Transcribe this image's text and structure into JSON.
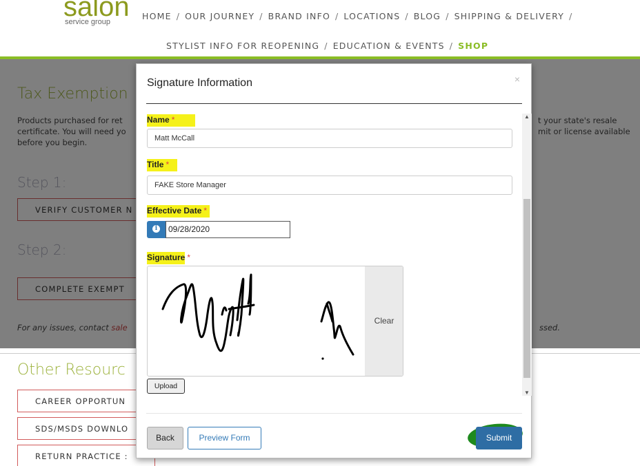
{
  "header": {
    "logo_word": "salon",
    "logo_sub": "service group",
    "nav_row1": [
      "HOME",
      "OUR JOURNEY",
      "BRAND INFO",
      "LOCATIONS",
      "BLOG",
      "SHIPPING & DELIVERY"
    ],
    "nav_row2": [
      "STYLIST INFO FOR REOPENING",
      "EDUCATION & EVENTS"
    ],
    "nav_active": "SHOP",
    "separator": "/",
    "accent_color": "#8bbd26"
  },
  "background": {
    "title": "Tax Exemption",
    "para_left": [
      "Products purchased for ret",
      "certificate. You will need yo",
      "before you begin."
    ],
    "para_right": [
      "t your state's resale",
      "mit or license available"
    ],
    "step1": "Step 1:",
    "verify_btn": "VERIFY CUSTOMER N",
    "step2": "Step 2:",
    "complete_btn": "COMPLETE EXEMPT",
    "contact_prefix": "For any issues, contact ",
    "contact_link": "sale",
    "contact_suffix": "ssed.",
    "resources_title": "Other Resourc",
    "resource_buttons": [
      "CAREER OPPORTUN",
      "SDS/MSDS DOWNLO",
      "RETURN PRACTICE :"
    ]
  },
  "modal": {
    "title": "Signature Information",
    "close": "×",
    "name_label": "Name",
    "name_value": "Matt McCall",
    "title_label": "Title",
    "title_value": "FAKE Store Manager",
    "date_label": "Effective Date",
    "date_value": "09/28/2020",
    "date_icon": "i",
    "signature_label": "Signature",
    "required_mark": "*",
    "clear_label": "Clear",
    "upload_label": "Upload",
    "back_label": "Back",
    "preview_label": "Preview Form",
    "submit_label": "Submit",
    "primary_color": "#337ab7",
    "highlight_color": "#f5f11a"
  }
}
